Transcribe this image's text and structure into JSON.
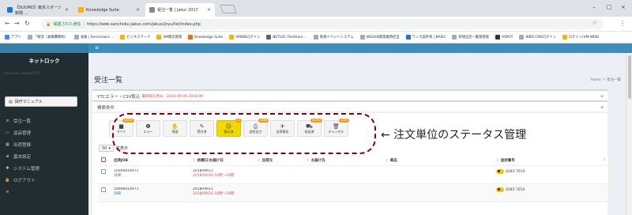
{
  "browser": {
    "tabs": [
      {
        "label": "【SUUMO】東京スポーツ新聞 …",
        "icon": "mail-icon",
        "color": "#1a73e8"
      },
      {
        "label": "Knowledge Suite",
        "icon": "ks-icon",
        "color": "#f4b400"
      },
      {
        "label": "受注一覧 | Jakur 2017",
        "icon": "page-icon",
        "color": "#888888"
      }
    ],
    "secure_label": "保護された通信",
    "url": "https://web-sanchoku.jakux.com/jakux/jnyu/list/index.php",
    "bookmarks": [
      {
        "label": "アプリ",
        "color": "#4285f4"
      },
      {
        "label": "「物流（倉庫費節約）",
        "color": "#aaaaaa"
      },
      {
        "label": "会員 | Servicelocs ...",
        "color": "#aaaaaa"
      },
      {
        "label": "ビジネスマーク",
        "color": "#f4b400"
      },
      {
        "label": "VM懸念管理",
        "color": "#f4b400"
      },
      {
        "label": "Knowledge Suite",
        "color": "#e8710a"
      },
      {
        "label": "VMWBログイン",
        "color": "#f4b400"
      },
      {
        "label": "NETLOC FileShare ...",
        "color": "#5f6368"
      },
      {
        "label": "新規イベントシステム",
        "color": "#aaaaaa"
      },
      {
        "label": "NISSAN管理業務担当",
        "color": "#aaaaaa"
      },
      {
        "label": "ワンカ案件系 | BASIC",
        "color": "#1a73e8"
      },
      {
        "label": "新規出店一覧管理者",
        "color": "#aaaaaa"
      },
      {
        "label": "ASPOT",
        "color": "#333333"
      },
      {
        "label": "WBD CMSログイン",
        "color": "#aaaaaa"
      },
      {
        "label": "ログイン(VM-WEB)",
        "color": "#f4b400"
      }
    ],
    "window_controls": [
      "–",
      "□",
      "×"
    ]
  },
  "sidebar": {
    "brand": "ネットロック",
    "user": "sanchoku jakux2017",
    "manual_button": "操作マニュアル",
    "items": [
      {
        "label": "受注一覧",
        "icon": "list-icon",
        "glyph": "≡"
      },
      {
        "label": "返品管理",
        "icon": "return-icon",
        "glyph": "▭"
      },
      {
        "label": "出荷登録",
        "icon": "shipping-icon",
        "glyph": "▦"
      },
      {
        "label": "基本設定",
        "icon": "settings-icon",
        "glyph": "▰"
      },
      {
        "label": "システム管理",
        "icon": "gear-icon",
        "glyph": "✱"
      },
      {
        "label": "ログアウト",
        "icon": "lock-icon",
        "glyph": "🔒"
      },
      {
        "label": "",
        "icon": "menu-icon",
        "glyph": "≡"
      }
    ]
  },
  "page": {
    "title": "受注一覧",
    "breadcrumb": "Home ＞ 受注一覧",
    "ytc_label": "YTCエラー・CSV取込",
    "ytc_error": "最終取込済み：2018-09-09 2018.99",
    "search_label": "検索条件"
  },
  "status_buttons": [
    {
      "label": "すべて",
      "count": "10569",
      "glyph": "■",
      "icon": "all-icon",
      "active": false
    },
    {
      "label": "エラー",
      "count": "",
      "glyph": "❶",
      "icon": "error-icon",
      "active": false
    },
    {
      "label": "保留",
      "count": "",
      "glyph": "✋",
      "icon": "hold-icon",
      "active": false
    },
    {
      "label": "受付済",
      "count": "",
      "glyph": "✎",
      "icon": "accepted-icon",
      "active": false
    },
    {
      "label": "指示済",
      "count": "14",
      "glyph": "☺",
      "icon": "instructed-icon",
      "active": true
    },
    {
      "label": "送状出力",
      "count": "1088",
      "glyph": "⎙",
      "icon": "print-icon",
      "active": false
    },
    {
      "label": "出荷報告",
      "count": "",
      "glyph": "✈",
      "icon": "send-icon",
      "active": false
    },
    {
      "label": "発送済",
      "count": "81780",
      "glyph": "⛟",
      "icon": "truck-icon",
      "active": false
    },
    {
      "label": "キャンセル",
      "count": "1131",
      "glyph": "🗑",
      "icon": "trash-icon",
      "active": false
    }
  ],
  "annotation": "← 注文単位のステータス管理",
  "per_page": {
    "value": "50",
    "suffix": "件表示"
  },
  "table": {
    "headers": [
      "",
      "出荷JOB",
      "依頼日/お届け日",
      "出荷元",
      "お届け先",
      "商品",
      "送状番号"
    ],
    "rows": [
      {
        "job": "10000014971",
        "job_link": "詳細",
        "request_date": "2018/09/11",
        "delivery": "2018/09/26 16時〜18時",
        "tracking": "4283 7014"
      },
      {
        "job": "10000014971",
        "job_link": "詳細",
        "request_date": "2018/09/11",
        "delivery": "2018/09/26 16時〜18時",
        "tracking": "4283 7014"
      }
    ]
  }
}
